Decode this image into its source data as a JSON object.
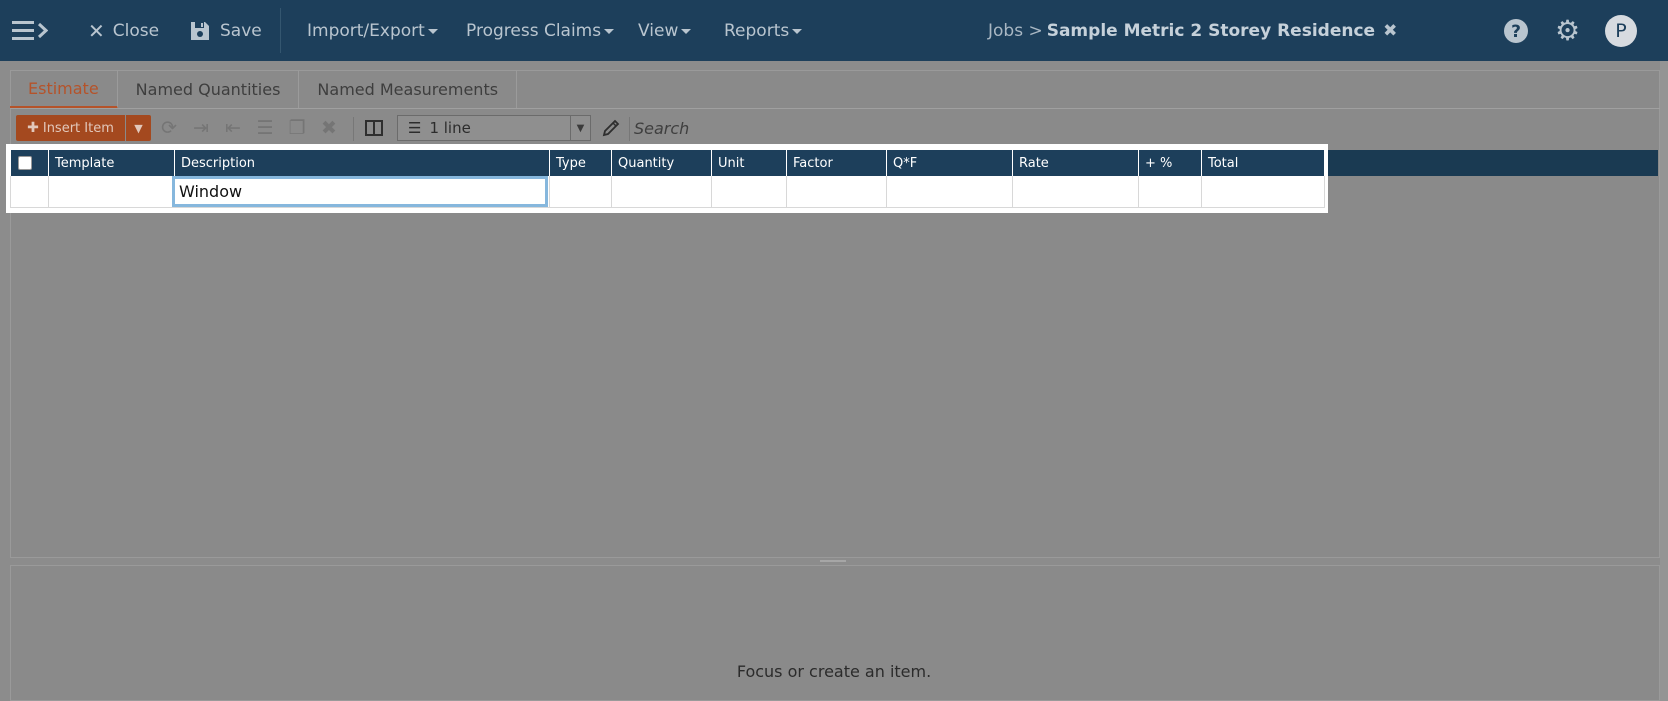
{
  "topbar": {
    "close_label": "Close",
    "save_label": "Save",
    "menus": [
      "Import/Export",
      "Progress Claims",
      "View",
      "Reports"
    ],
    "breadcrumb_root": "Jobs >",
    "job_name": "Sample Metric 2 Storey Residence",
    "avatar_initial": "P"
  },
  "tabs": [
    "Estimate",
    "Named Quantities",
    "Named Measurements"
  ],
  "toolbar": {
    "insert_label": "Insert Item",
    "lines_value": "1 line",
    "search_placeholder": "Search"
  },
  "grid": {
    "columns": [
      "Template",
      "Description",
      "Type",
      "Quantity",
      "Unit",
      "Factor",
      "Q*F",
      "Rate",
      "+ %",
      "Total"
    ],
    "rows": [
      {
        "template": "",
        "description": "Window",
        "type": "",
        "quantity": "",
        "unit": "",
        "factor": "",
        "qf": "",
        "rate": "",
        "pct": "",
        "total": ""
      }
    ]
  },
  "detail": {
    "message": "Focus or create an item."
  },
  "colors": {
    "navbar": "#1d3f5b",
    "accent": "#b5532a",
    "header": "#1d3f5b"
  }
}
